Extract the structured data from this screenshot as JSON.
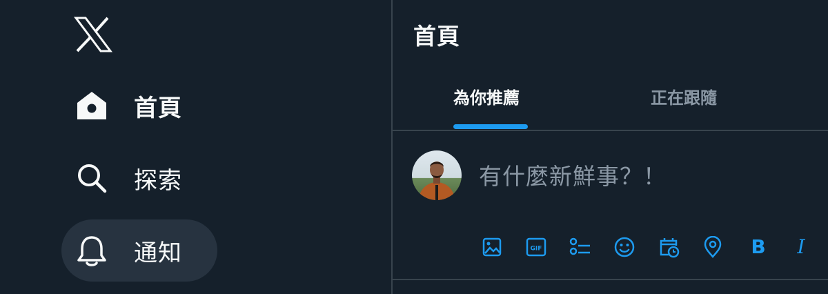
{
  "sidebar": {
    "logo": "x-logo-icon",
    "items": [
      {
        "label": "首頁",
        "icon": "home-icon"
      },
      {
        "label": "探索",
        "icon": "search-icon"
      },
      {
        "label": "通知",
        "icon": "bell-icon"
      }
    ]
  },
  "main": {
    "title": "首頁",
    "tabs": [
      {
        "label": "為你推薦",
        "active": true
      },
      {
        "label": "正在跟隨",
        "active": false
      }
    ],
    "compose": {
      "placeholder": "有什麼新鮮事？！",
      "tools": [
        "image-icon",
        "gif-icon",
        "poll-icon",
        "emoji-icon",
        "schedule-icon",
        "location-icon",
        "bold-icon",
        "italic-icon"
      ],
      "bold_label": "B",
      "italic_label": "I",
      "gif_label": "GIF"
    }
  },
  "colors": {
    "background": "#15202b",
    "accent": "#1d9bf0",
    "text": "#f7f9f9",
    "muted": "#8b98a5",
    "border": "#38444d"
  }
}
